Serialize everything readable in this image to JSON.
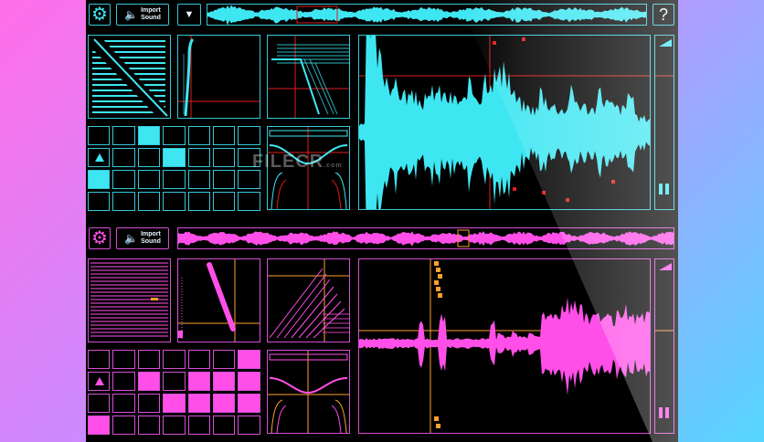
{
  "app": {
    "help_label": "?",
    "watermark": "FILECR",
    "watermark_suffix": ".com"
  },
  "colors": {
    "cyan": "#3ee6f2",
    "magenta": "#ff4fe8",
    "orange": "#ff9f2f",
    "red": "#e21b1b",
    "background": "#000000"
  },
  "deck_top": {
    "import_label": "Import\nSound",
    "icons": [
      "gear-icon",
      "speaker-icon",
      "chevron-down-icon",
      "help-icon",
      "triangle-icon",
      "pause-icon"
    ],
    "pad_grid": {
      "rows": 4,
      "cols": 7,
      "active": [
        [
          0,
          2
        ],
        [
          1,
          3
        ],
        [
          2,
          0
        ]
      ],
      "triangle_cell": [
        1,
        0
      ]
    }
  },
  "deck_bottom": {
    "import_label": "Import\nSound",
    "icons": [
      "gear-icon",
      "speaker-icon",
      "triangle-icon",
      "pause-icon"
    ],
    "pad_grid": {
      "rows": 4,
      "cols": 7,
      "active": [
        [
          0,
          6
        ],
        [
          1,
          2
        ],
        [
          1,
          4
        ],
        [
          1,
          5
        ],
        [
          1,
          6
        ],
        [
          2,
          3
        ],
        [
          2,
          4
        ],
        [
          2,
          5
        ],
        [
          2,
          6
        ],
        [
          3,
          0
        ]
      ],
      "triangle_cell": [
        1,
        0
      ]
    }
  }
}
